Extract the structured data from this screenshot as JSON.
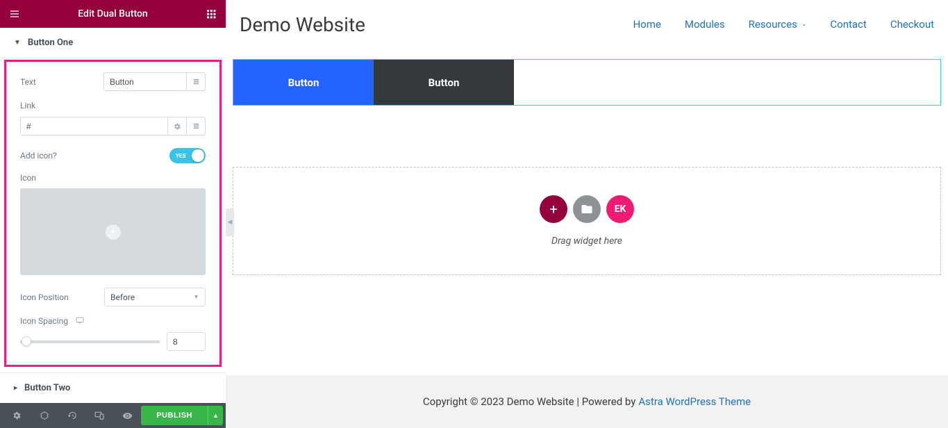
{
  "panel": {
    "title": "Edit Dual Button",
    "section1": {
      "title": "Button One",
      "text_label": "Text",
      "text_value": "Button",
      "link_label": "Link",
      "link_value": "#",
      "addicon_label": "Add icon?",
      "addicon_toggle": "YES",
      "icon_label": "Icon",
      "iconpos_label": "Icon Position",
      "iconpos_value": "Before",
      "iconspacing_label": "Icon Spacing",
      "iconspacing_value": "8"
    },
    "section2": {
      "title": "Button Two"
    },
    "footer": {
      "publish": "PUBLISH"
    }
  },
  "preview": {
    "site_title": "Demo Website",
    "nav": [
      "Home",
      "Modules",
      "Resources",
      "Contact",
      "Checkout"
    ],
    "dual": {
      "btn1": "Button",
      "btn2": "Button"
    },
    "drop": {
      "kit_label": "EK",
      "text": "Drag widget here"
    },
    "footer": {
      "copyright": "Copyright © 2023 Demo Website | Powered by ",
      "theme": "Astra WordPress Theme"
    }
  }
}
